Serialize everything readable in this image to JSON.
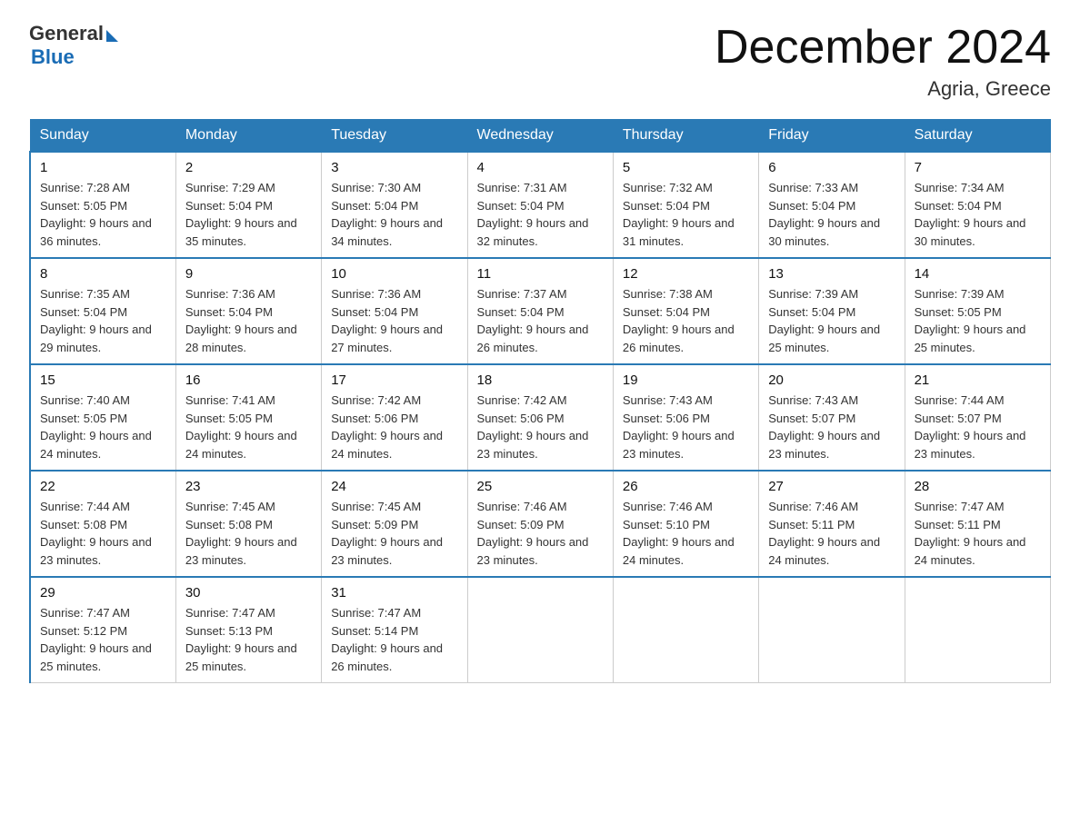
{
  "logo": {
    "general": "General",
    "arrow": "▶",
    "blue": "Blue"
  },
  "title": "December 2024",
  "subtitle": "Agria, Greece",
  "headers": [
    "Sunday",
    "Monday",
    "Tuesday",
    "Wednesday",
    "Thursday",
    "Friday",
    "Saturday"
  ],
  "weeks": [
    [
      {
        "day": "1",
        "sunrise": "7:28 AM",
        "sunset": "5:05 PM",
        "daylight": "9 hours and 36 minutes."
      },
      {
        "day": "2",
        "sunrise": "7:29 AM",
        "sunset": "5:04 PM",
        "daylight": "9 hours and 35 minutes."
      },
      {
        "day": "3",
        "sunrise": "7:30 AM",
        "sunset": "5:04 PM",
        "daylight": "9 hours and 34 minutes."
      },
      {
        "day": "4",
        "sunrise": "7:31 AM",
        "sunset": "5:04 PM",
        "daylight": "9 hours and 32 minutes."
      },
      {
        "day": "5",
        "sunrise": "7:32 AM",
        "sunset": "5:04 PM",
        "daylight": "9 hours and 31 minutes."
      },
      {
        "day": "6",
        "sunrise": "7:33 AM",
        "sunset": "5:04 PM",
        "daylight": "9 hours and 30 minutes."
      },
      {
        "day": "7",
        "sunrise": "7:34 AM",
        "sunset": "5:04 PM",
        "daylight": "9 hours and 30 minutes."
      }
    ],
    [
      {
        "day": "8",
        "sunrise": "7:35 AM",
        "sunset": "5:04 PM",
        "daylight": "9 hours and 29 minutes."
      },
      {
        "day": "9",
        "sunrise": "7:36 AM",
        "sunset": "5:04 PM",
        "daylight": "9 hours and 28 minutes."
      },
      {
        "day": "10",
        "sunrise": "7:36 AM",
        "sunset": "5:04 PM",
        "daylight": "9 hours and 27 minutes."
      },
      {
        "day": "11",
        "sunrise": "7:37 AM",
        "sunset": "5:04 PM",
        "daylight": "9 hours and 26 minutes."
      },
      {
        "day": "12",
        "sunrise": "7:38 AM",
        "sunset": "5:04 PM",
        "daylight": "9 hours and 26 minutes."
      },
      {
        "day": "13",
        "sunrise": "7:39 AM",
        "sunset": "5:04 PM",
        "daylight": "9 hours and 25 minutes."
      },
      {
        "day": "14",
        "sunrise": "7:39 AM",
        "sunset": "5:05 PM",
        "daylight": "9 hours and 25 minutes."
      }
    ],
    [
      {
        "day": "15",
        "sunrise": "7:40 AM",
        "sunset": "5:05 PM",
        "daylight": "9 hours and 24 minutes."
      },
      {
        "day": "16",
        "sunrise": "7:41 AM",
        "sunset": "5:05 PM",
        "daylight": "9 hours and 24 minutes."
      },
      {
        "day": "17",
        "sunrise": "7:42 AM",
        "sunset": "5:06 PM",
        "daylight": "9 hours and 24 minutes."
      },
      {
        "day": "18",
        "sunrise": "7:42 AM",
        "sunset": "5:06 PM",
        "daylight": "9 hours and 23 minutes."
      },
      {
        "day": "19",
        "sunrise": "7:43 AM",
        "sunset": "5:06 PM",
        "daylight": "9 hours and 23 minutes."
      },
      {
        "day": "20",
        "sunrise": "7:43 AM",
        "sunset": "5:07 PM",
        "daylight": "9 hours and 23 minutes."
      },
      {
        "day": "21",
        "sunrise": "7:44 AM",
        "sunset": "5:07 PM",
        "daylight": "9 hours and 23 minutes."
      }
    ],
    [
      {
        "day": "22",
        "sunrise": "7:44 AM",
        "sunset": "5:08 PM",
        "daylight": "9 hours and 23 minutes."
      },
      {
        "day": "23",
        "sunrise": "7:45 AM",
        "sunset": "5:08 PM",
        "daylight": "9 hours and 23 minutes."
      },
      {
        "day": "24",
        "sunrise": "7:45 AM",
        "sunset": "5:09 PM",
        "daylight": "9 hours and 23 minutes."
      },
      {
        "day": "25",
        "sunrise": "7:46 AM",
        "sunset": "5:09 PM",
        "daylight": "9 hours and 23 minutes."
      },
      {
        "day": "26",
        "sunrise": "7:46 AM",
        "sunset": "5:10 PM",
        "daylight": "9 hours and 24 minutes."
      },
      {
        "day": "27",
        "sunrise": "7:46 AM",
        "sunset": "5:11 PM",
        "daylight": "9 hours and 24 minutes."
      },
      {
        "day": "28",
        "sunrise": "7:47 AM",
        "sunset": "5:11 PM",
        "daylight": "9 hours and 24 minutes."
      }
    ],
    [
      {
        "day": "29",
        "sunrise": "7:47 AM",
        "sunset": "5:12 PM",
        "daylight": "9 hours and 25 minutes."
      },
      {
        "day": "30",
        "sunrise": "7:47 AM",
        "sunset": "5:13 PM",
        "daylight": "9 hours and 25 minutes."
      },
      {
        "day": "31",
        "sunrise": "7:47 AM",
        "sunset": "5:14 PM",
        "daylight": "9 hours and 26 minutes."
      },
      null,
      null,
      null,
      null
    ]
  ]
}
